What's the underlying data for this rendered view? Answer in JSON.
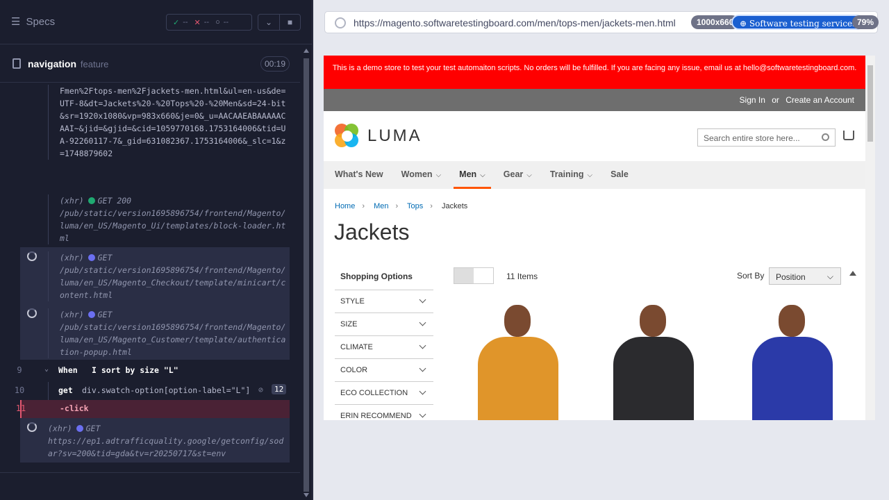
{
  "runner": {
    "specs_label": "Specs",
    "stats": {
      "passed": "--",
      "failed": "--",
      "pending": "--"
    },
    "file_name": "navigation",
    "file_suffix": "feature",
    "timer": "00:19"
  },
  "log": {
    "top_fragment": "Fmen%2Ftops-men%2Fjackets-men.html&ul=en-us&de=UTF-8&dt=Jackets%20-%20Tops%20-%20Men&sd=24-bit&sr=1920x1080&vp=983x660&je=0&_u=AACAAEABAAAAACAAI~&jid=&gjid=&cid=1059770168.1753164006&tid=UA-92260117-7&_gid=631082367.1753164006&_slc=1&z=1748879602",
    "xhr1": {
      "type": "(xhr)",
      "method": "GET 200",
      "url": "/pub/static/version1695896754/frontend/Magento/luma/en_US/Magento_Ui/templates/block-loader.html"
    },
    "xhr2": {
      "type": "(xhr)",
      "method": "GET",
      "url": "/pub/static/version1695896754/frontend/Magento/luma/en_US/Magento_Checkout/template/minicart/content.html"
    },
    "xhr3": {
      "type": "(xhr)",
      "method": "GET",
      "url": "/pub/static/version1695896754/frontend/Magento/luma/en_US/Magento_Customer/template/authentication-popup.html"
    },
    "step9": {
      "num": "9",
      "keyword": "When",
      "text": "I sort by size \"L\""
    },
    "step10": {
      "num": "10",
      "cmd": "get",
      "selector": "div.swatch-option[option-label=\"L\"]",
      "count": "12"
    },
    "step11": {
      "num": "11",
      "cmd": "-click"
    },
    "xhr4": {
      "type": "(xhr)",
      "method": "GET",
      "url": "https://ep1.adtrafficquality.google/getconfig/sodar?sv=200&tid=gda&tv=r20250717&st=env"
    }
  },
  "browser": {
    "url": "https://magento.softwaretestingboard.com/men/tops-men/jackets-men.html",
    "viewport": "1000x660",
    "sts_badge": "Software testing services",
    "zoom": "79%"
  },
  "store": {
    "banner": "This is a demo store to test your test automaiton scripts. No orders will be fulfilled. If you are facing any issue, email us at hello@softwaretestingboard.com.",
    "sign_in": "Sign In",
    "or": "or",
    "create_account": "Create an Account",
    "logo_text": "LUMA",
    "search_placeholder": "Search entire store here...",
    "nav": [
      "What's New",
      "Women",
      "Men",
      "Gear",
      "Training",
      "Sale"
    ],
    "breadcrumbs": [
      "Home",
      "Men",
      "Tops",
      "Jackets"
    ],
    "page_title": "Jackets",
    "shopping_options": "Shopping Options",
    "filters": [
      "STYLE",
      "SIZE",
      "CLIMATE",
      "COLOR",
      "ECO COLLECTION",
      "ERIN RECOMMEND"
    ],
    "items_count": "11 Items",
    "sort_by": "Sort By",
    "sort_value": "Position",
    "products": [
      {
        "color": "#e0952a"
      },
      {
        "color": "#2b2b2e"
      },
      {
        "color": "#2b3aa8"
      }
    ]
  }
}
